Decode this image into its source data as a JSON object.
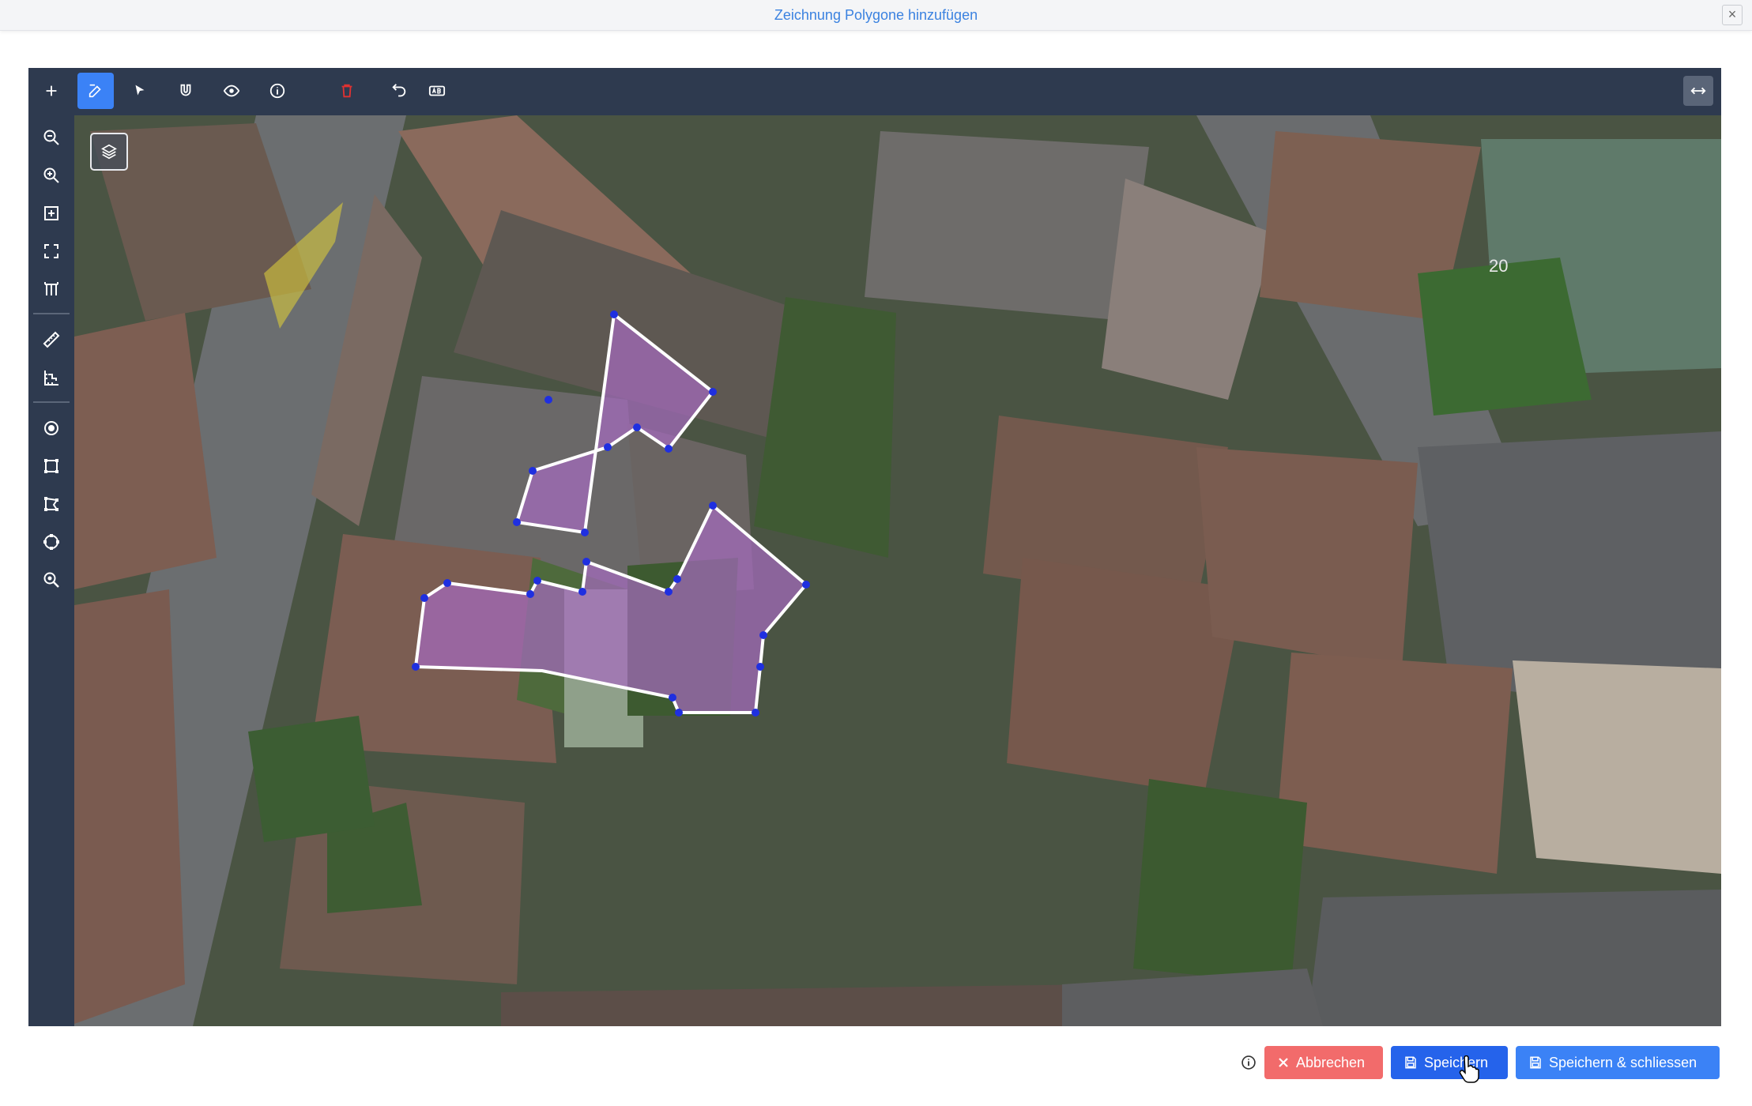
{
  "dialog": {
    "title": "Zeichnung Polygone hinzufügen",
    "close_label": "×"
  },
  "toolbar": {
    "tools": [
      {
        "name": "add-icon",
        "active": false
      },
      {
        "name": "edit-icon",
        "active": true
      },
      {
        "name": "select-icon",
        "active": false
      },
      {
        "name": "magnet-icon",
        "active": false
      },
      {
        "name": "eye-icon",
        "active": false
      },
      {
        "name": "info-icon",
        "active": false
      },
      {
        "name": "delete-icon",
        "active": false
      },
      {
        "name": "undo-icon",
        "active": false
      },
      {
        "name": "label-icon",
        "active": false
      }
    ],
    "expand_icon": "expand-horizontal-icon"
  },
  "sidebar": {
    "tools": [
      "zoom-out-icon",
      "zoom-in-icon",
      "zoom-box-icon",
      "full-extent-icon",
      "scale-bar-icon",
      "measure-distance-icon",
      "measure-area-icon",
      "point-icon",
      "polygon-icon",
      "polygon-edit-icon",
      "circle-icon",
      "zoom-search-icon"
    ]
  },
  "map": {
    "layer_switcher_icon": "layers-icon",
    "polygon_fill": "#a66bc0",
    "polygon_stroke": "#ffffff",
    "vertex_color": "#1f2fe0",
    "street_marking": "20"
  },
  "footer": {
    "info_icon": "info-icon",
    "cancel_label": "Abbrechen",
    "save_label": "Speichern",
    "save_close_label": "Speichern & schliessen",
    "colors": {
      "cancel": "#f26b6b",
      "save": "#2563eb",
      "save_close": "#3b82f6"
    }
  }
}
